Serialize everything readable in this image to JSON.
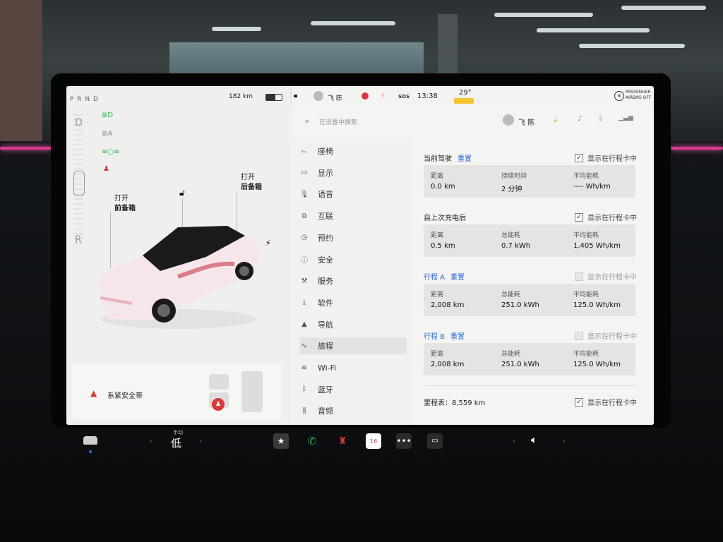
{
  "status": {
    "gears": "P R N D",
    "range": "182 km",
    "driver_name": "飞 陈",
    "sos": "SOS",
    "time": "13:38",
    "temperature": "29°",
    "airbag_line1": "PASSENGER",
    "airbag_line2": "AIRBAG OFF"
  },
  "left": {
    "gear_D": "D",
    "gear_R": "R",
    "frunk_line1": "打开",
    "frunk_line2": "前备箱",
    "trunk_line1": "打开",
    "trunk_line2": "后备箱",
    "seatbelt_alert": "系紧安全带"
  },
  "search": {
    "placeholder": "在设置中搜索",
    "profile_name": "飞 陈"
  },
  "nav": [
    {
      "label": "座椅",
      "icon": "seat-icon"
    },
    {
      "label": "显示",
      "icon": "display-icon"
    },
    {
      "label": "语音",
      "icon": "microphone-icon"
    },
    {
      "label": "互联",
      "icon": "connectivity-icon"
    },
    {
      "label": "预约",
      "icon": "clock-icon"
    },
    {
      "label": "安全",
      "icon": "safety-icon"
    },
    {
      "label": "服务",
      "icon": "wrench-icon"
    },
    {
      "label": "软件",
      "icon": "download-icon"
    },
    {
      "label": "导航",
      "icon": "navigation-icon"
    },
    {
      "label": "旅程",
      "icon": "trip-icon",
      "active": true
    },
    {
      "label": "Wi-Fi",
      "icon": "wifi-icon"
    },
    {
      "label": "蓝牙",
      "icon": "bluetooth-icon"
    },
    {
      "label": "音频",
      "icon": "audio-icon"
    }
  ],
  "trips": {
    "current": {
      "title": "当前驾驶",
      "reset": "重置",
      "show": "显示在行程卡中",
      "checked": true,
      "cols": [
        {
          "label": "距离",
          "value": "0.0  km"
        },
        {
          "label": "持续时间",
          "value": "2 分钟"
        },
        {
          "label": "平均能耗",
          "value": "---- Wh/km"
        }
      ]
    },
    "since_charge": {
      "title": "自上次充电后",
      "show": "显示在行程卡中",
      "checked": true,
      "cols": [
        {
          "label": "距离",
          "value": "0.5  km"
        },
        {
          "label": "总能耗",
          "value": "0.7  kWh"
        },
        {
          "label": "平均能耗",
          "value": "1,405  Wh/km"
        }
      ]
    },
    "trip_a": {
      "title": "行程 A",
      "reset": "重置",
      "show": "显示在行程卡中",
      "checked": false,
      "cols": [
        {
          "label": "距离",
          "value": "2,008  km"
        },
        {
          "label": "总能耗",
          "value": "251.0  kWh"
        },
        {
          "label": "平均能耗",
          "value": "125.0  Wh/km"
        }
      ]
    },
    "trip_b": {
      "title": "行程 B",
      "reset": "重置",
      "show": "显示在行程卡中",
      "checked": false,
      "cols": [
        {
          "label": "距离",
          "value": "2,008  km"
        },
        {
          "label": "总能耗",
          "value": "251.0  kWh"
        },
        {
          "label": "平均能耗",
          "value": "125.0  Wh/km"
        }
      ]
    },
    "odometer": {
      "label": "里程表：8,559 km",
      "show": "显示在行程卡中",
      "checked": true
    }
  },
  "dock": {
    "fan_mode": "手动",
    "fan_level": "低",
    "calendar_day": "16"
  },
  "colors": {
    "accent_blue": "#2a6dd6",
    "light_green": "#2fb24a",
    "alert_red": "#d63a3a"
  }
}
